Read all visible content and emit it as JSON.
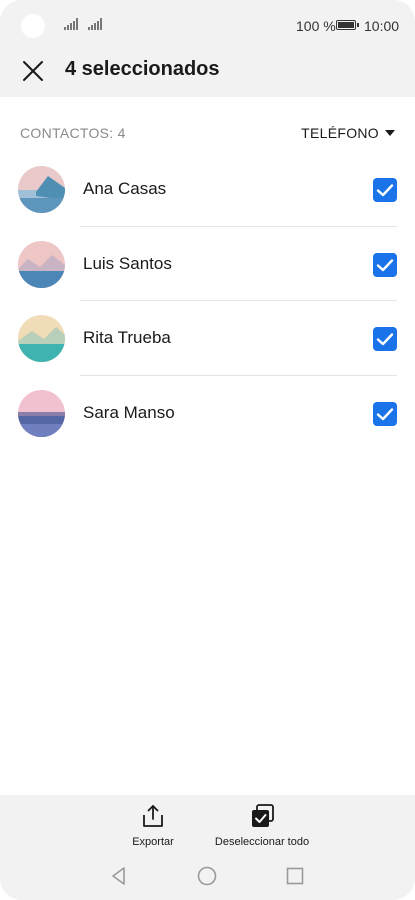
{
  "status_bar": {
    "battery_percent": "100 %",
    "time": "10:00",
    "icons": [
      "camera-cutout",
      "signal-icon",
      "signal-icon",
      "battery-icon"
    ]
  },
  "header": {
    "title": "4 seleccionados",
    "close_icon": "close-icon"
  },
  "list_header": {
    "count_label": "CONTACTOS: 4",
    "filter_label": "TELÉFONO",
    "filter_icon": "caret-down-icon"
  },
  "contacts": [
    {
      "name": "Ana Casas",
      "checked": true,
      "avatar_colors": [
        "#e9c9c9",
        "#4e8fb3"
      ]
    },
    {
      "name": "Luis Santos",
      "checked": true,
      "avatar_colors": [
        "#efc6c6",
        "#4b86b6"
      ]
    },
    {
      "name": "Rita Trueba",
      "checked": true,
      "avatar_colors": [
        "#f0dcb6",
        "#3fb3b0"
      ]
    },
    {
      "name": "Sara Manso",
      "checked": true,
      "avatar_colors": [
        "#f2c1cf",
        "#5566a5"
      ]
    }
  ],
  "bottom_actions": [
    {
      "label": "Exportar",
      "icon": "share-export-icon"
    },
    {
      "label": "Deseleccionar todo",
      "icon": "deselect-all-icon"
    }
  ],
  "nav_bar": [
    "back-icon",
    "home-icon",
    "recents-icon"
  ],
  "colors": {
    "accent": "#1a73e8",
    "background": "#f2f2f2",
    "surface": "#ffffff"
  }
}
